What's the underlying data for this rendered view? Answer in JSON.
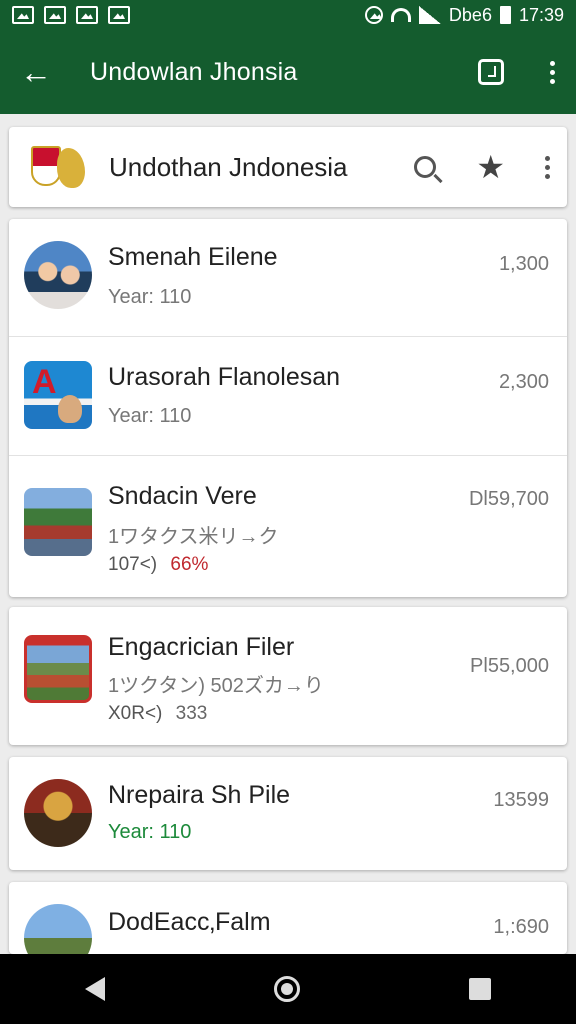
{
  "status_bar": {
    "left_icons": [
      "image-icon",
      "photo-icon",
      "image-icon",
      "check-box-icon"
    ],
    "carrier": "Dbe6",
    "time": "17:39"
  },
  "app_bar": {
    "title": "Undowlan Jhonsia",
    "back_icon": "arrow-back-icon",
    "actions": [
      "save-icon",
      "more-vert-icon"
    ]
  },
  "search_card": {
    "title": "Undothan Jndonesia",
    "actions": [
      "search-icon",
      "star-icon",
      "more-vert-icon"
    ]
  },
  "list": [
    {
      "name": "Smenah Eilene",
      "sub": "Year: 110",
      "value": "1,300",
      "thumb": "couple-portrait"
    },
    {
      "name": "Urasorah Flanolesan",
      "sub": "Year: 110",
      "value": "2,300",
      "thumb": "logo-portrait"
    },
    {
      "name": "Sndacin Vere",
      "sub": "1ワタクス米リ→ク",
      "meta_a": "107<)",
      "meta_b": "66%",
      "value": "Dl59,700",
      "thumb": "temple-scene"
    },
    {
      "name": "Engacrician Filer",
      "sub": "1ツクタン) 502ズカ→り",
      "meta_a": "X0R<)",
      "meta_b": "333",
      "value": "Pl55,000",
      "thumb": "landmark-scene"
    },
    {
      "name": "Nrepaira Sh Pile",
      "sub": "Year: 110",
      "value": "13599",
      "thumb": "ornament-scene"
    },
    {
      "name": "DodEacc‚Falm",
      "sub": "",
      "value": "1,:690",
      "thumb": "tower-scene"
    }
  ],
  "nav_bar": [
    "back-nav-icon",
    "home-nav-icon",
    "recents-nav-icon"
  ],
  "colors": {
    "primary": "#145c2e",
    "accent_green": "#1d8a3b",
    "accent_red": "#c0292f"
  }
}
